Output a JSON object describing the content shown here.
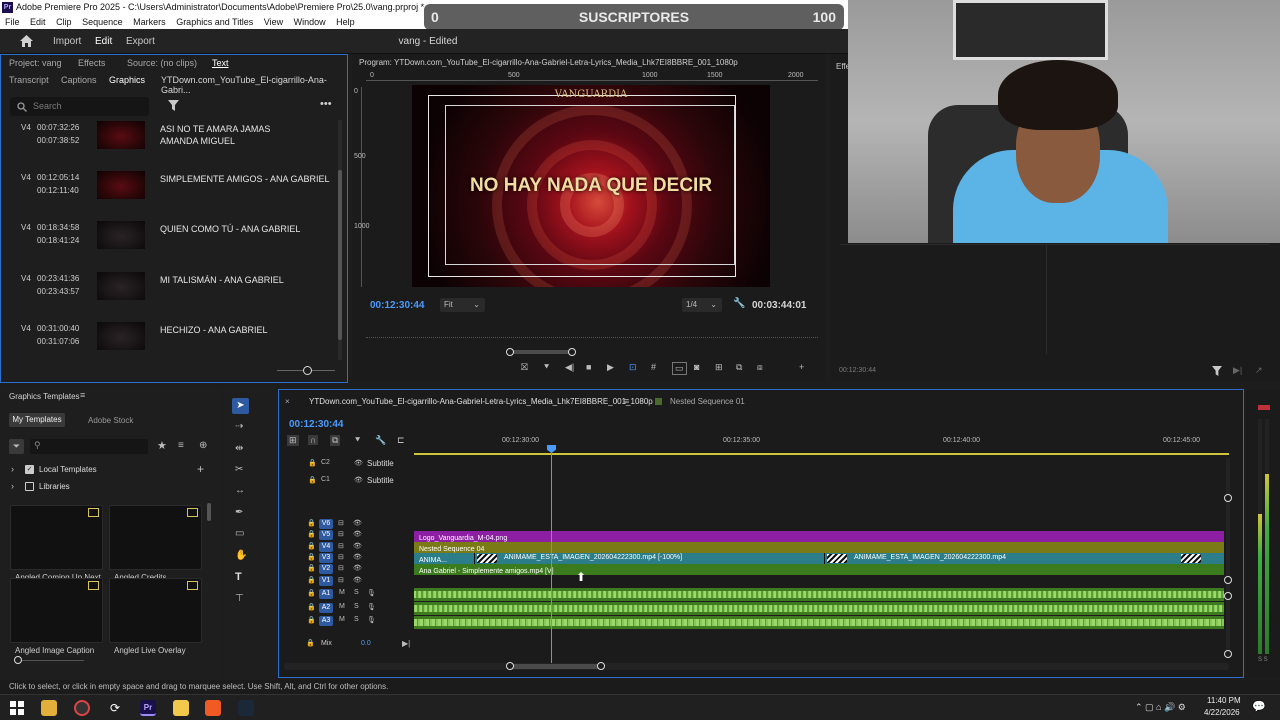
{
  "window": {
    "title": "Adobe Premiere Pro 2025 - C:\\Users\\Administrator\\Documents\\Adobe\\Premiere Pro\\25.0\\vang.prproj *"
  },
  "menu": [
    "File",
    "Edit",
    "Clip",
    "Sequence",
    "Markers",
    "Graphics and Titles",
    "View",
    "Window",
    "Help"
  ],
  "subscribers": {
    "left": "0",
    "label": "SUSCRIPTORES",
    "right": "100"
  },
  "topnav": {
    "import": "Import",
    "edit": "Edit",
    "export": "Export",
    "document": "vang - Edited"
  },
  "left_panel": {
    "tabs_row1": [
      "Project: vang",
      "Effects",
      "Source: (no clips)",
      "Text"
    ],
    "tabs_row2": [
      "Transcript",
      "Captions",
      "Graphics",
      "YTDown.com_YouTube_El-cigarrillo-Ana-Gabri..."
    ],
    "search_placeholder": "Search",
    "clips": [
      {
        "track": "V4",
        "start": "00:07:32:26",
        "end": "00:07:38:52",
        "name": "ASI NO TE AMARA JAMAS",
        "name2": "AMANDA MIGUEL",
        "dark": false
      },
      {
        "track": "V4",
        "start": "00:12:05:14",
        "end": "00:12:11:40",
        "name": "SIMPLEMENTE AMIGOS - ANA GABRIEL",
        "name2": "",
        "dark": false
      },
      {
        "track": "V4",
        "start": "00:18:34:58",
        "end": "00:18:41:24",
        "name": "QUIEN COMO TÚ - ANA GABRIEL",
        "name2": "",
        "dark": true
      },
      {
        "track": "V4",
        "start": "00:23:41:36",
        "end": "00:23:43:57",
        "name": "MI TALISMÁN - ANA GABRIEL",
        "name2": "",
        "dark": true
      },
      {
        "track": "V4",
        "start": "00:31:00:40",
        "end": "00:31:07:06",
        "name": "HECHIZO - ANA GABRIEL",
        "name2": "",
        "dark": true
      }
    ]
  },
  "program": {
    "title": "Program: YTDown.com_YouTube_El-cigarrillo-Ana-Gabriel-Letra-Lyrics_Media_Lhk7EI8BBRE_001_1080p",
    "ruler": [
      "0",
      "500",
      "1000",
      "1500",
      "2000"
    ],
    "vruler": [
      "0",
      "500",
      "1000"
    ],
    "overlay_text": "NO HAY NADA QUE DECIR",
    "logo_text": "VANGUARDIA",
    "timecode": "00:12:30:44",
    "fit": "Fit",
    "resolution": "1/4",
    "duration": "00:03:44:01"
  },
  "effects": {
    "tab": "Effe",
    "timecode": "00:12:30:44"
  },
  "graphics_templates": {
    "title": "Graphics Templates",
    "tabs": [
      "My Templates",
      "Adobe Stock"
    ],
    "folders": [
      "Local Templates",
      "Libraries"
    ],
    "templates": [
      "Angled Coming Up Next",
      "Angled Credits",
      "Angled Image Caption",
      "Angled Live Overlay"
    ]
  },
  "timeline": {
    "seq_tabs": [
      "YTDown.com_YouTube_El-cigarrillo-Ana-Gabriel-Letra-Lyrics_Media_Lhk7EI8BBRE_001_1080p",
      "Nested Sequence 01"
    ],
    "timecode": "00:12:30:44",
    "ruler": [
      "00:12:30:00",
      "00:12:35:00",
      "00:12:40:00",
      "00:12:45:00"
    ],
    "subtitle_tracks": [
      {
        "id": "C2",
        "label": "Subtitle"
      },
      {
        "id": "C1",
        "label": "Subtitle"
      }
    ],
    "video_tracks": [
      "V6",
      "V5",
      "V4",
      "V3",
      "V2",
      "V1"
    ],
    "audio_tracks": [
      "A1",
      "A2",
      "A3"
    ],
    "mix_label": "Mix",
    "mix_value": "0.0",
    "clips": {
      "v5": "Logo_Vanguardia_M-04.png",
      "v4": "Nested Sequence 04",
      "v3a": "ANIMA...",
      "v3b": "ANIMAME_ESTA_IMAGEN_202604222300.mp4 [-100%]",
      "v3c": "ANIMAME_ESTA_IMAGEN_202604222300.mp4",
      "v2": "Ana Gabriel - Simplemente amigos.mp4 [V]"
    },
    "colors": {
      "v5": "#8d1fa5",
      "v4": "#7a7a17",
      "v3": "#2b7d8a",
      "v2": "#3c7a1e",
      "audio": "#3e7a1f"
    }
  },
  "status": "Click to select, or click in empty space and drag to marquee select. Use Shift, Alt, and Ctrl for other options.",
  "taskbar": {
    "time": "11:40 PM",
    "date": "4/22/2026"
  }
}
